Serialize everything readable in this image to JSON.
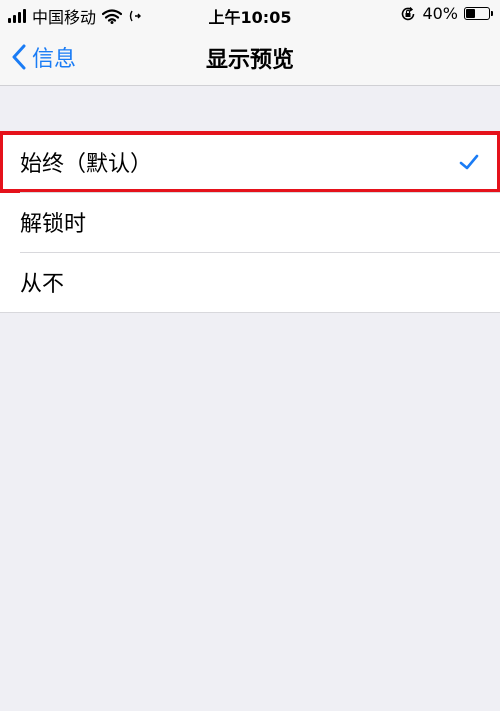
{
  "status_bar": {
    "carrier": "中国移动",
    "time": "上午10:05",
    "battery_percent": "40%",
    "battery_level": 0.4
  },
  "nav": {
    "back_label": "信息",
    "title": "显示预览"
  },
  "options": [
    {
      "label": "始终（默认）",
      "selected": true
    },
    {
      "label": "解锁时",
      "selected": false
    },
    {
      "label": "从不",
      "selected": false
    }
  ],
  "colors": {
    "accent": "#1a7cf5",
    "highlight_border": "#e5121b",
    "background": "#efeff4"
  },
  "icons": {
    "back": "chevron-left-icon",
    "check": "checkmark-icon",
    "wifi": "wifi-icon",
    "signal": "signal-bars-icon",
    "battery": "battery-icon",
    "orientation_lock": "orientation-lock-icon"
  }
}
